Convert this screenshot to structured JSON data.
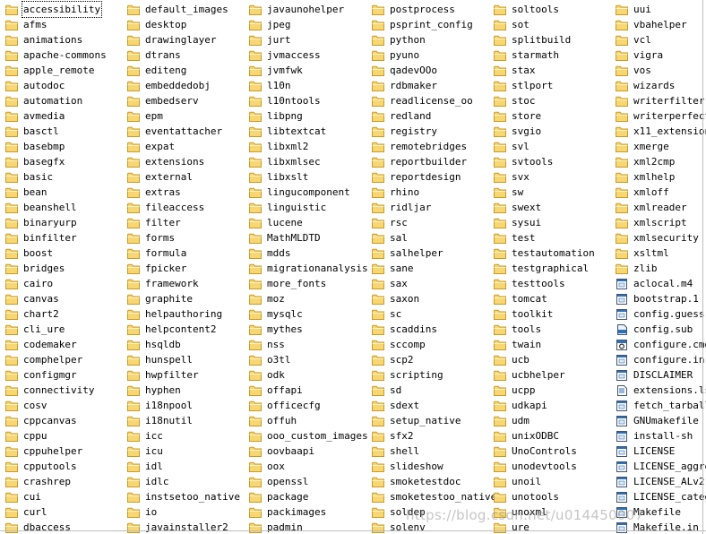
{
  "columns": [
    {
      "items": [
        {
          "name": "accessibility",
          "type": "folder",
          "selected": true
        },
        {
          "name": "afms",
          "type": "folder"
        },
        {
          "name": "animations",
          "type": "folder"
        },
        {
          "name": "apache-commons",
          "type": "folder"
        },
        {
          "name": "apple_remote",
          "type": "folder"
        },
        {
          "name": "autodoc",
          "type": "folder"
        },
        {
          "name": "automation",
          "type": "folder"
        },
        {
          "name": "avmedia",
          "type": "folder"
        },
        {
          "name": "basctl",
          "type": "folder"
        },
        {
          "name": "basebmp",
          "type": "folder"
        },
        {
          "name": "basegfx",
          "type": "folder"
        },
        {
          "name": "basic",
          "type": "folder"
        },
        {
          "name": "bean",
          "type": "folder"
        },
        {
          "name": "beanshell",
          "type": "folder"
        },
        {
          "name": "binaryurp",
          "type": "folder"
        },
        {
          "name": "binfilter",
          "type": "folder"
        },
        {
          "name": "boost",
          "type": "folder"
        },
        {
          "name": "bridges",
          "type": "folder"
        },
        {
          "name": "cairo",
          "type": "folder"
        },
        {
          "name": "canvas",
          "type": "folder"
        },
        {
          "name": "chart2",
          "type": "folder"
        },
        {
          "name": "cli_ure",
          "type": "folder"
        },
        {
          "name": "codemaker",
          "type": "folder"
        },
        {
          "name": "comphelper",
          "type": "folder"
        },
        {
          "name": "configmgr",
          "type": "folder"
        },
        {
          "name": "connectivity",
          "type": "folder"
        },
        {
          "name": "cosv",
          "type": "folder"
        },
        {
          "name": "cppcanvas",
          "type": "folder"
        },
        {
          "name": "cppu",
          "type": "folder"
        },
        {
          "name": "cppuhelper",
          "type": "folder"
        },
        {
          "name": "cpputools",
          "type": "folder"
        },
        {
          "name": "crashrep",
          "type": "folder"
        },
        {
          "name": "cui",
          "type": "folder"
        },
        {
          "name": "curl",
          "type": "folder"
        },
        {
          "name": "dbaccess",
          "type": "folder"
        }
      ]
    },
    {
      "items": [
        {
          "name": "default_images",
          "type": "folder"
        },
        {
          "name": "desktop",
          "type": "folder"
        },
        {
          "name": "drawinglayer",
          "type": "folder"
        },
        {
          "name": "dtrans",
          "type": "folder"
        },
        {
          "name": "editeng",
          "type": "folder"
        },
        {
          "name": "embeddedobj",
          "type": "folder"
        },
        {
          "name": "embedserv",
          "type": "folder"
        },
        {
          "name": "epm",
          "type": "folder"
        },
        {
          "name": "eventattacher",
          "type": "folder"
        },
        {
          "name": "expat",
          "type": "folder"
        },
        {
          "name": "extensions",
          "type": "folder"
        },
        {
          "name": "external",
          "type": "folder"
        },
        {
          "name": "extras",
          "type": "folder"
        },
        {
          "name": "fileaccess",
          "type": "folder"
        },
        {
          "name": "filter",
          "type": "folder"
        },
        {
          "name": "forms",
          "type": "folder"
        },
        {
          "name": "formula",
          "type": "folder"
        },
        {
          "name": "fpicker",
          "type": "folder"
        },
        {
          "name": "framework",
          "type": "folder"
        },
        {
          "name": "graphite",
          "type": "folder"
        },
        {
          "name": "helpauthoring",
          "type": "folder"
        },
        {
          "name": "helpcontent2",
          "type": "folder"
        },
        {
          "name": "hsqldb",
          "type": "folder"
        },
        {
          "name": "hunspell",
          "type": "folder"
        },
        {
          "name": "hwpfilter",
          "type": "folder"
        },
        {
          "name": "hyphen",
          "type": "folder"
        },
        {
          "name": "i18npool",
          "type": "folder"
        },
        {
          "name": "i18nutil",
          "type": "folder"
        },
        {
          "name": "icc",
          "type": "folder"
        },
        {
          "name": "icu",
          "type": "folder"
        },
        {
          "name": "idl",
          "type": "folder"
        },
        {
          "name": "idlc",
          "type": "folder"
        },
        {
          "name": "instsetoo_native",
          "type": "folder"
        },
        {
          "name": "io",
          "type": "folder"
        },
        {
          "name": "javainstaller2",
          "type": "folder"
        }
      ]
    },
    {
      "items": [
        {
          "name": "javaunohelper",
          "type": "folder"
        },
        {
          "name": "jpeg",
          "type": "folder"
        },
        {
          "name": "jurt",
          "type": "folder"
        },
        {
          "name": "jvmaccess",
          "type": "folder"
        },
        {
          "name": "jvmfwk",
          "type": "folder"
        },
        {
          "name": "l10n",
          "type": "folder"
        },
        {
          "name": "l10ntools",
          "type": "folder"
        },
        {
          "name": "libpng",
          "type": "folder"
        },
        {
          "name": "libtextcat",
          "type": "folder"
        },
        {
          "name": "libxml2",
          "type": "folder"
        },
        {
          "name": "libxmlsec",
          "type": "folder"
        },
        {
          "name": "libxslt",
          "type": "folder"
        },
        {
          "name": "lingucomponent",
          "type": "folder"
        },
        {
          "name": "linguistic",
          "type": "folder"
        },
        {
          "name": "lucene",
          "type": "folder"
        },
        {
          "name": "MathMLDTD",
          "type": "folder"
        },
        {
          "name": "mdds",
          "type": "folder"
        },
        {
          "name": "migrationanalysis",
          "type": "folder"
        },
        {
          "name": "more_fonts",
          "type": "folder"
        },
        {
          "name": "moz",
          "type": "folder"
        },
        {
          "name": "mysqlc",
          "type": "folder"
        },
        {
          "name": "mythes",
          "type": "folder"
        },
        {
          "name": "nss",
          "type": "folder"
        },
        {
          "name": "o3tl",
          "type": "folder"
        },
        {
          "name": "odk",
          "type": "folder"
        },
        {
          "name": "offapi",
          "type": "folder"
        },
        {
          "name": "officecfg",
          "type": "folder"
        },
        {
          "name": "offuh",
          "type": "folder"
        },
        {
          "name": "ooo_custom_images",
          "type": "folder"
        },
        {
          "name": "oovbaapi",
          "type": "folder"
        },
        {
          "name": "oox",
          "type": "folder"
        },
        {
          "name": "openssl",
          "type": "folder"
        },
        {
          "name": "package",
          "type": "folder"
        },
        {
          "name": "packimages",
          "type": "folder"
        },
        {
          "name": "padmin",
          "type": "folder"
        }
      ]
    },
    {
      "items": [
        {
          "name": "postprocess",
          "type": "folder"
        },
        {
          "name": "psprint_config",
          "type": "folder"
        },
        {
          "name": "python",
          "type": "folder"
        },
        {
          "name": "pyuno",
          "type": "folder"
        },
        {
          "name": "qadevOOo",
          "type": "folder"
        },
        {
          "name": "rdbmaker",
          "type": "folder"
        },
        {
          "name": "readlicense_oo",
          "type": "folder"
        },
        {
          "name": "redland",
          "type": "folder"
        },
        {
          "name": "registry",
          "type": "folder"
        },
        {
          "name": "remotebridges",
          "type": "folder"
        },
        {
          "name": "reportbuilder",
          "type": "folder"
        },
        {
          "name": "reportdesign",
          "type": "folder"
        },
        {
          "name": "rhino",
          "type": "folder"
        },
        {
          "name": "ridljar",
          "type": "folder"
        },
        {
          "name": "rsc",
          "type": "folder"
        },
        {
          "name": "sal",
          "type": "folder"
        },
        {
          "name": "salhelper",
          "type": "folder"
        },
        {
          "name": "sane",
          "type": "folder"
        },
        {
          "name": "sax",
          "type": "folder"
        },
        {
          "name": "saxon",
          "type": "folder"
        },
        {
          "name": "sc",
          "type": "folder"
        },
        {
          "name": "scaddins",
          "type": "folder"
        },
        {
          "name": "sccomp",
          "type": "folder"
        },
        {
          "name": "scp2",
          "type": "folder"
        },
        {
          "name": "scripting",
          "type": "folder"
        },
        {
          "name": "sd",
          "type": "folder"
        },
        {
          "name": "sdext",
          "type": "folder"
        },
        {
          "name": "setup_native",
          "type": "folder"
        },
        {
          "name": "sfx2",
          "type": "folder"
        },
        {
          "name": "shell",
          "type": "folder"
        },
        {
          "name": "slideshow",
          "type": "folder"
        },
        {
          "name": "smoketestdoc",
          "type": "folder"
        },
        {
          "name": "smoketestoo_native",
          "type": "folder"
        },
        {
          "name": "soldep",
          "type": "folder"
        },
        {
          "name": "solenv",
          "type": "folder"
        }
      ]
    },
    {
      "items": [
        {
          "name": "soltools",
          "type": "folder"
        },
        {
          "name": "sot",
          "type": "folder"
        },
        {
          "name": "splitbuild",
          "type": "folder"
        },
        {
          "name": "starmath",
          "type": "folder"
        },
        {
          "name": "stax",
          "type": "folder"
        },
        {
          "name": "stlport",
          "type": "folder"
        },
        {
          "name": "stoc",
          "type": "folder"
        },
        {
          "name": "store",
          "type": "folder"
        },
        {
          "name": "svgio",
          "type": "folder"
        },
        {
          "name": "svl",
          "type": "folder"
        },
        {
          "name": "svtools",
          "type": "folder"
        },
        {
          "name": "svx",
          "type": "folder"
        },
        {
          "name": "sw",
          "type": "folder"
        },
        {
          "name": "swext",
          "type": "folder"
        },
        {
          "name": "sysui",
          "type": "folder"
        },
        {
          "name": "test",
          "type": "folder"
        },
        {
          "name": "testautomation",
          "type": "folder"
        },
        {
          "name": "testgraphical",
          "type": "folder"
        },
        {
          "name": "testtools",
          "type": "folder"
        },
        {
          "name": "tomcat",
          "type": "folder"
        },
        {
          "name": "toolkit",
          "type": "folder"
        },
        {
          "name": "tools",
          "type": "folder"
        },
        {
          "name": "twain",
          "type": "folder"
        },
        {
          "name": "ucb",
          "type": "folder"
        },
        {
          "name": "ucbhelper",
          "type": "folder"
        },
        {
          "name": "ucpp",
          "type": "folder"
        },
        {
          "name": "udkapi",
          "type": "folder"
        },
        {
          "name": "udm",
          "type": "folder"
        },
        {
          "name": "unixODBC",
          "type": "folder"
        },
        {
          "name": "UnoControls",
          "type": "folder"
        },
        {
          "name": "unodevtools",
          "type": "folder"
        },
        {
          "name": "unoil",
          "type": "folder"
        },
        {
          "name": "unotools",
          "type": "folder"
        },
        {
          "name": "unoxml",
          "type": "folder"
        },
        {
          "name": "ure",
          "type": "folder"
        }
      ]
    },
    {
      "items": [
        {
          "name": "uui",
          "type": "folder"
        },
        {
          "name": "vbahelper",
          "type": "folder"
        },
        {
          "name": "vcl",
          "type": "folder"
        },
        {
          "name": "vigra",
          "type": "folder"
        },
        {
          "name": "vos",
          "type": "folder"
        },
        {
          "name": "wizards",
          "type": "folder"
        },
        {
          "name": "writerfilter",
          "type": "folder"
        },
        {
          "name": "writerperfect",
          "type": "folder"
        },
        {
          "name": "x11_extensions",
          "type": "folder"
        },
        {
          "name": "xmerge",
          "type": "folder"
        },
        {
          "name": "xml2cmp",
          "type": "folder"
        },
        {
          "name": "xmlhelp",
          "type": "folder"
        },
        {
          "name": "xmloff",
          "type": "folder"
        },
        {
          "name": "xmlreader",
          "type": "folder"
        },
        {
          "name": "xmlscript",
          "type": "folder"
        },
        {
          "name": "xmlsecurity",
          "type": "folder"
        },
        {
          "name": "xsltml",
          "type": "folder"
        },
        {
          "name": "zlib",
          "type": "folder"
        },
        {
          "name": "aclocal.m4",
          "type": "file"
        },
        {
          "name": "bootstrap.1",
          "type": "file"
        },
        {
          "name": "config.guess",
          "type": "file"
        },
        {
          "name": "config.sub",
          "type": "file-sub"
        },
        {
          "name": "configure.cmd",
          "type": "file-cmd"
        },
        {
          "name": "configure.in",
          "type": "file"
        },
        {
          "name": "DISCLAIMER",
          "type": "file"
        },
        {
          "name": "extensions.lst",
          "type": "file-text"
        },
        {
          "name": "fetch_tarballs.",
          "type": "file"
        },
        {
          "name": "GNUmakefile",
          "type": "file"
        },
        {
          "name": "install-sh",
          "type": "file"
        },
        {
          "name": "LICENSE",
          "type": "file"
        },
        {
          "name": "LICENSE_aggrega",
          "type": "file"
        },
        {
          "name": "LICENSE_ALv2",
          "type": "file"
        },
        {
          "name": "LICENSE_categor",
          "type": "file"
        },
        {
          "name": "Makefile",
          "type": "file"
        },
        {
          "name": "Makefile.in",
          "type": "file"
        }
      ]
    }
  ],
  "watermark": "https://blog.csdn.net/u014450007",
  "colors": {
    "folder_fill": "#f7d774",
    "folder_stroke": "#c99a24",
    "file_border": "#44546a",
    "file_blue": "#2f6fb5"
  }
}
